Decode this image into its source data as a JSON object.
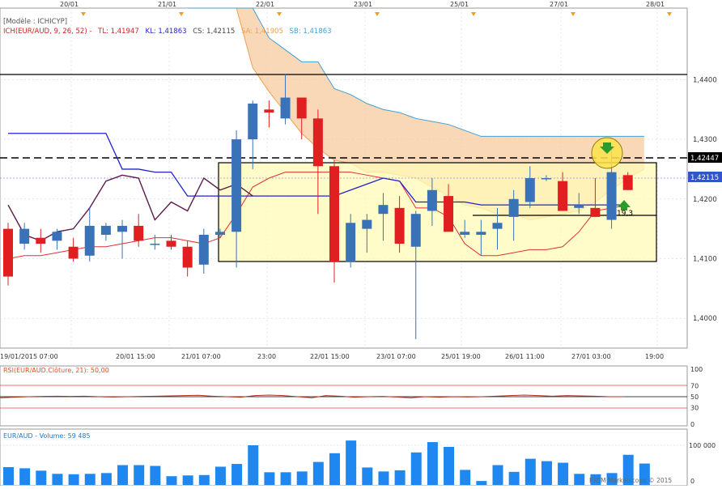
{
  "header": {
    "model": "[Modèle : ICHICYP]",
    "ich": "ICH(EUR/AUD, 9, 26, 52) -",
    "tl": "TL: 1,41947",
    "kl": "KL: 1,41863",
    "cs": "CS: 1,42115",
    "sa": "SA: 1,41905",
    "sb": "SB: 1,41863"
  },
  "top_dates": [
    "20/01",
    "21/01",
    "22/01",
    "23/01",
    "25/01",
    "27/01",
    "28/01"
  ],
  "x_labels": [
    "19/01/2015 07:00",
    "20/01 15:00",
    "21/01 07:00",
    "23:00",
    "22/01 15:00",
    "23/01 07:00",
    "25/01 19:00",
    "26/01 11:00",
    "27/01 03:00",
    "19:00"
  ],
  "price_ticks": [
    "1,4400",
    "1,4300",
    "1,4200",
    "1,4100",
    "1,4000"
  ],
  "price_marker_black": "1,42447",
  "price_marker_blue": "1,42115",
  "annotation_value": "19,3",
  "rsi": {
    "title": "RSI(EUR/AUD.Clôture, 21): 50,00",
    "ticks": [
      "100",
      "70",
      "50",
      "30",
      "0"
    ],
    "values": [
      48,
      49,
      50,
      50.5,
      51,
      50.5,
      51,
      50,
      49.5,
      50,
      50.5,
      51,
      51.5,
      52,
      52.5,
      51,
      50,
      49,
      52,
      53,
      52,
      50,
      48,
      52,
      51,
      49,
      50,
      50.5,
      49.5,
      48,
      50,
      49,
      50,
      49.5,
      50,
      51,
      52,
      53,
      52,
      51,
      52,
      51.5,
      51,
      50,
      50
    ]
  },
  "volume": {
    "title": "EUR/AUD - Volume: 59 485",
    "ticks": [
      "100 000",
      "0"
    ],
    "values": [
      45000,
      42000,
      36000,
      28000,
      27000,
      28000,
      30000,
      50000,
      50000,
      48000,
      22000,
      24000,
      25000,
      46000,
      53000,
      100000,
      32000,
      32000,
      34000,
      58000,
      80000,
      112000,
      44000,
      34000,
      37000,
      82000,
      108000,
      96000,
      38000,
      10000,
      50000,
      33000,
      66000,
      60000,
      56000,
      28000,
      27000,
      30000,
      76000,
      54000
    ]
  },
  "footer": "FXCM Marketscope © 2015",
  "chart_data": {
    "type": "candlestick",
    "pair": "EUR/AUD",
    "ylim": [
      1.395,
      1.452
    ],
    "ohlc": [
      [
        1.415,
        1.416,
        1.4055,
        1.407
      ],
      [
        1.4125,
        1.416,
        1.4115,
        1.415
      ],
      [
        1.4135,
        1.415,
        1.411,
        1.4125
      ],
      [
        1.413,
        1.415,
        1.4115,
        1.4145
      ],
      [
        1.412,
        1.4135,
        1.4095,
        1.41
      ],
      [
        1.4105,
        1.4185,
        1.4095,
        1.4155
      ],
      [
        1.414,
        1.416,
        1.413,
        1.4155
      ],
      [
        1.4145,
        1.4165,
        1.41,
        1.4155
      ],
      [
        1.4155,
        1.4175,
        1.412,
        1.413
      ],
      [
        1.4125,
        1.414,
        1.4115,
        1.4125
      ],
      [
        1.413,
        1.414,
        1.4115,
        1.412
      ],
      [
        1.412,
        1.413,
        1.407,
        1.4085
      ],
      [
        1.409,
        1.415,
        1.4075,
        1.414
      ],
      [
        1.414,
        1.415,
        1.4135,
        1.4145
      ],
      [
        1.4145,
        1.4315,
        1.4085,
        1.43
      ],
      [
        1.43,
        1.4365,
        1.425,
        1.436
      ],
      [
        1.435,
        1.4365,
        1.432,
        1.4345
      ],
      [
        1.4335,
        1.441,
        1.4325,
        1.437
      ],
      [
        1.437,
        1.4365,
        1.43,
        1.4335
      ],
      [
        1.4335,
        1.435,
        1.4175,
        1.4255
      ],
      [
        1.4255,
        1.4265,
        1.406,
        1.4095
      ],
      [
        1.4095,
        1.4175,
        1.4085,
        1.416
      ],
      [
        1.415,
        1.4175,
        1.411,
        1.4165
      ],
      [
        1.4175,
        1.421,
        1.413,
        1.419
      ],
      [
        1.4185,
        1.4205,
        1.411,
        1.4125
      ],
      [
        1.412,
        1.418,
        1.3965,
        1.4175
      ],
      [
        1.418,
        1.4235,
        1.4155,
        1.4215
      ],
      [
        1.4205,
        1.4225,
        1.4145,
        1.4145
      ],
      [
        1.414,
        1.4165,
        1.4135,
        1.4145
      ],
      [
        1.414,
        1.4165,
        1.4105,
        1.4145
      ],
      [
        1.415,
        1.4185,
        1.4115,
        1.416
      ],
      [
        1.417,
        1.4215,
        1.413,
        1.42
      ],
      [
        1.4195,
        1.4255,
        1.4185,
        1.4235
      ],
      [
        1.4235,
        1.424,
        1.423,
        1.4235
      ],
      [
        1.423,
        1.4245,
        1.418,
        1.418
      ],
      [
        1.4185,
        1.421,
        1.4175,
        1.419
      ],
      [
        1.4185,
        1.4235,
        1.417,
        1.417
      ],
      [
        1.4165,
        1.4285,
        1.415,
        1.4245
      ],
      [
        1.424,
        1.4245,
        1.4215,
        1.4215
      ]
    ],
    "tenkan": [
      1.41,
      1.4105,
      1.4105,
      1.411,
      1.4115,
      1.412,
      1.412,
      1.4125,
      1.413,
      1.4135,
      1.4135,
      1.413,
      1.4125,
      1.4135,
      1.4175,
      1.422,
      1.4235,
      1.4245,
      1.4245,
      1.4245,
      1.4245,
      1.4245,
      1.424,
      1.4235,
      1.423,
      1.4185,
      1.4185,
      1.417,
      1.4125,
      1.4105,
      1.4105,
      1.411,
      1.4115,
      1.4115,
      1.412,
      1.4145,
      1.418,
      1.4185,
      1.419
    ],
    "kijun": [
      1.431,
      1.431,
      1.431,
      1.431,
      1.431,
      1.431,
      1.431,
      1.425,
      1.425,
      1.4245,
      1.4245,
      1.4205,
      1.4205,
      1.4205,
      1.4205,
      1.4205,
      1.4205,
      1.4205,
      1.4205,
      1.4205,
      1.4205,
      1.4215,
      1.4225,
      1.4235,
      1.423,
      1.4195,
      1.4195,
      1.4195,
      1.4195,
      1.419,
      1.419,
      1.419,
      1.419,
      1.419,
      1.419,
      1.419,
      1.419,
      1.419,
      1.419
    ],
    "chikou": [
      1.419,
      1.414,
      1.413,
      1.4145,
      1.415,
      1.4185,
      1.423,
      1.424,
      1.4235,
      1.4165,
      1.4195,
      1.418,
      1.4235,
      1.4215,
      1.4225,
      1.4205
    ],
    "span_a": [
      1.452,
      1.452,
      1.452,
      1.452,
      1.442,
      1.438,
      1.4345,
      1.431,
      1.4285,
      1.4265,
      1.426,
      1.4245,
      1.4245,
      1.424,
      1.4235,
      1.422,
      1.4205,
      1.419,
      1.4185,
      1.4175,
      1.4175,
      1.4165,
      1.417,
      1.4175,
      1.418,
      1.4195,
      1.4215,
      1.4235,
      1.425
    ],
    "span_b": [
      1.452,
      1.452,
      1.452,
      1.452,
      1.452,
      1.447,
      1.445,
      1.443,
      1.443,
      1.4385,
      1.4375,
      1.436,
      1.435,
      1.4345,
      1.4335,
      1.433,
      1.4325,
      1.4315,
      1.4305,
      1.4305,
      1.4305,
      1.4305,
      1.4305,
      1.4305,
      1.4305,
      1.4305,
      1.4305,
      1.4305,
      1.4305
    ]
  }
}
